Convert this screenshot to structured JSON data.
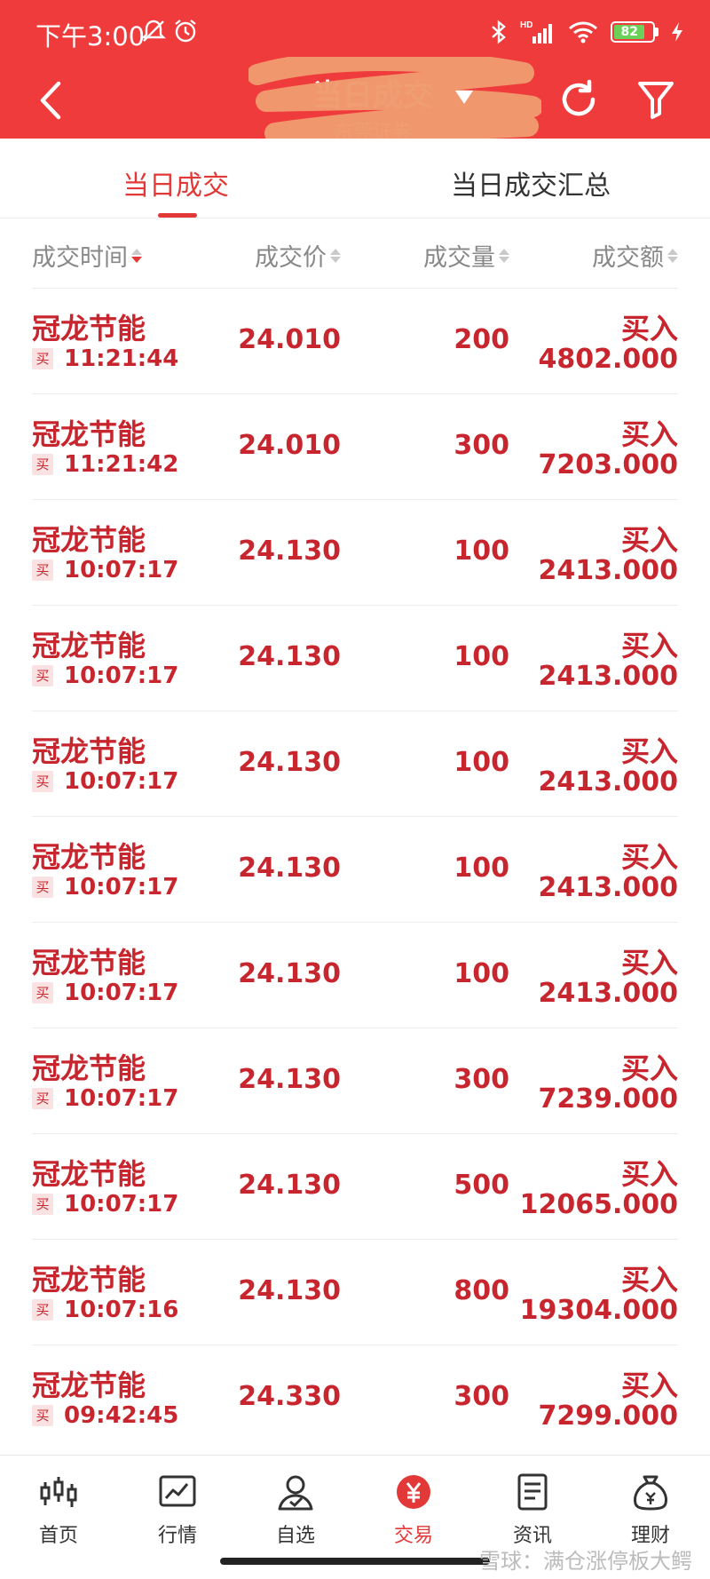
{
  "status_bar": {
    "time": "下午3:00",
    "battery": "82",
    "network": "HD"
  },
  "header": {
    "title": "当日成交",
    "subtitle": "东莞证券",
    "back_icon": "chevron-left-icon",
    "refresh_icon": "refresh-icon",
    "filter_icon": "filter-icon",
    "bg_color": "#ef3b3b"
  },
  "tabs": [
    {
      "label": "当日成交",
      "active": true
    },
    {
      "label": "当日成交汇总",
      "active": false
    }
  ],
  "columns": [
    "成交时间",
    "成交价",
    "成交量",
    "成交额"
  ],
  "rows": [
    {
      "name": "冠龙节能",
      "tag": "买",
      "time": "11:21:44",
      "price": "24.010",
      "qty": "200",
      "dir": "买入",
      "amount": "4802.000"
    },
    {
      "name": "冠龙节能",
      "tag": "买",
      "time": "11:21:42",
      "price": "24.010",
      "qty": "300",
      "dir": "买入",
      "amount": "7203.000"
    },
    {
      "name": "冠龙节能",
      "tag": "买",
      "time": "10:07:17",
      "price": "24.130",
      "qty": "100",
      "dir": "买入",
      "amount": "2413.000"
    },
    {
      "name": "冠龙节能",
      "tag": "买",
      "time": "10:07:17",
      "price": "24.130",
      "qty": "100",
      "dir": "买入",
      "amount": "2413.000"
    },
    {
      "name": "冠龙节能",
      "tag": "买",
      "time": "10:07:17",
      "price": "24.130",
      "qty": "100",
      "dir": "买入",
      "amount": "2413.000"
    },
    {
      "name": "冠龙节能",
      "tag": "买",
      "time": "10:07:17",
      "price": "24.130",
      "qty": "100",
      "dir": "买入",
      "amount": "2413.000"
    },
    {
      "name": "冠龙节能",
      "tag": "买",
      "time": "10:07:17",
      "price": "24.130",
      "qty": "100",
      "dir": "买入",
      "amount": "2413.000"
    },
    {
      "name": "冠龙节能",
      "tag": "买",
      "time": "10:07:17",
      "price": "24.130",
      "qty": "300",
      "dir": "买入",
      "amount": "7239.000"
    },
    {
      "name": "冠龙节能",
      "tag": "买",
      "time": "10:07:17",
      "price": "24.130",
      "qty": "500",
      "dir": "买入",
      "amount": "12065.000"
    },
    {
      "name": "冠龙节能",
      "tag": "买",
      "time": "10:07:16",
      "price": "24.130",
      "qty": "800",
      "dir": "买入",
      "amount": "19304.000"
    },
    {
      "name": "冠龙节能",
      "tag": "买",
      "time": "09:42:45",
      "price": "24.330",
      "qty": "300",
      "dir": "买入",
      "amount": "7299.000"
    }
  ],
  "bottom_nav": [
    {
      "label": "首页",
      "icon": "candlestick-icon",
      "active": false
    },
    {
      "label": "行情",
      "icon": "chart-icon",
      "active": false
    },
    {
      "label": "自选",
      "icon": "user-check-icon",
      "active": false
    },
    {
      "label": "交易",
      "icon": "yen-icon",
      "active": true
    },
    {
      "label": "资讯",
      "icon": "document-icon",
      "active": false
    },
    {
      "label": "理财",
      "icon": "money-bag-icon",
      "active": false
    }
  ],
  "watermark": "雪球：满仓涨停板大鳄",
  "accent_color": "#e33838",
  "value_color": "#c8262e"
}
